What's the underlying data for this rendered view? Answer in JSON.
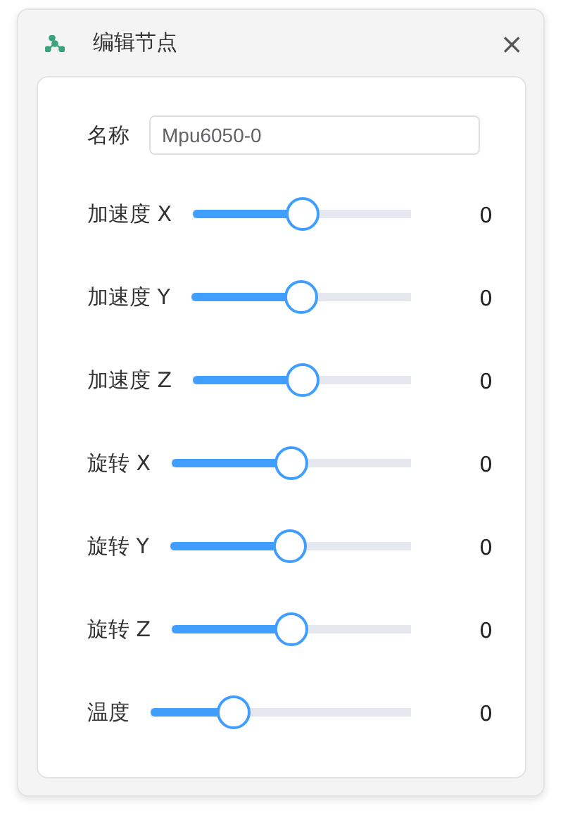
{
  "dialog": {
    "title": "编辑节点",
    "close": "×"
  },
  "name_field": {
    "label": "名称",
    "value": "Mpu6050-0"
  },
  "sliders": [
    {
      "label": "加速度 X",
      "level": 0.5,
      "reading": "0"
    },
    {
      "label": "加速度 Y",
      "level": 0.5,
      "reading": "0"
    },
    {
      "label": "加速度 Z",
      "level": 0.5,
      "reading": "0"
    },
    {
      "label": "旋转 X",
      "level": 0.5,
      "reading": "0"
    },
    {
      "label": "旋转 Y",
      "level": 0.5,
      "reading": "0"
    },
    {
      "label": "旋转 Z",
      "level": 0.5,
      "reading": "0"
    },
    {
      "label": "温度",
      "level": 0.32,
      "reading": "0"
    }
  ]
}
